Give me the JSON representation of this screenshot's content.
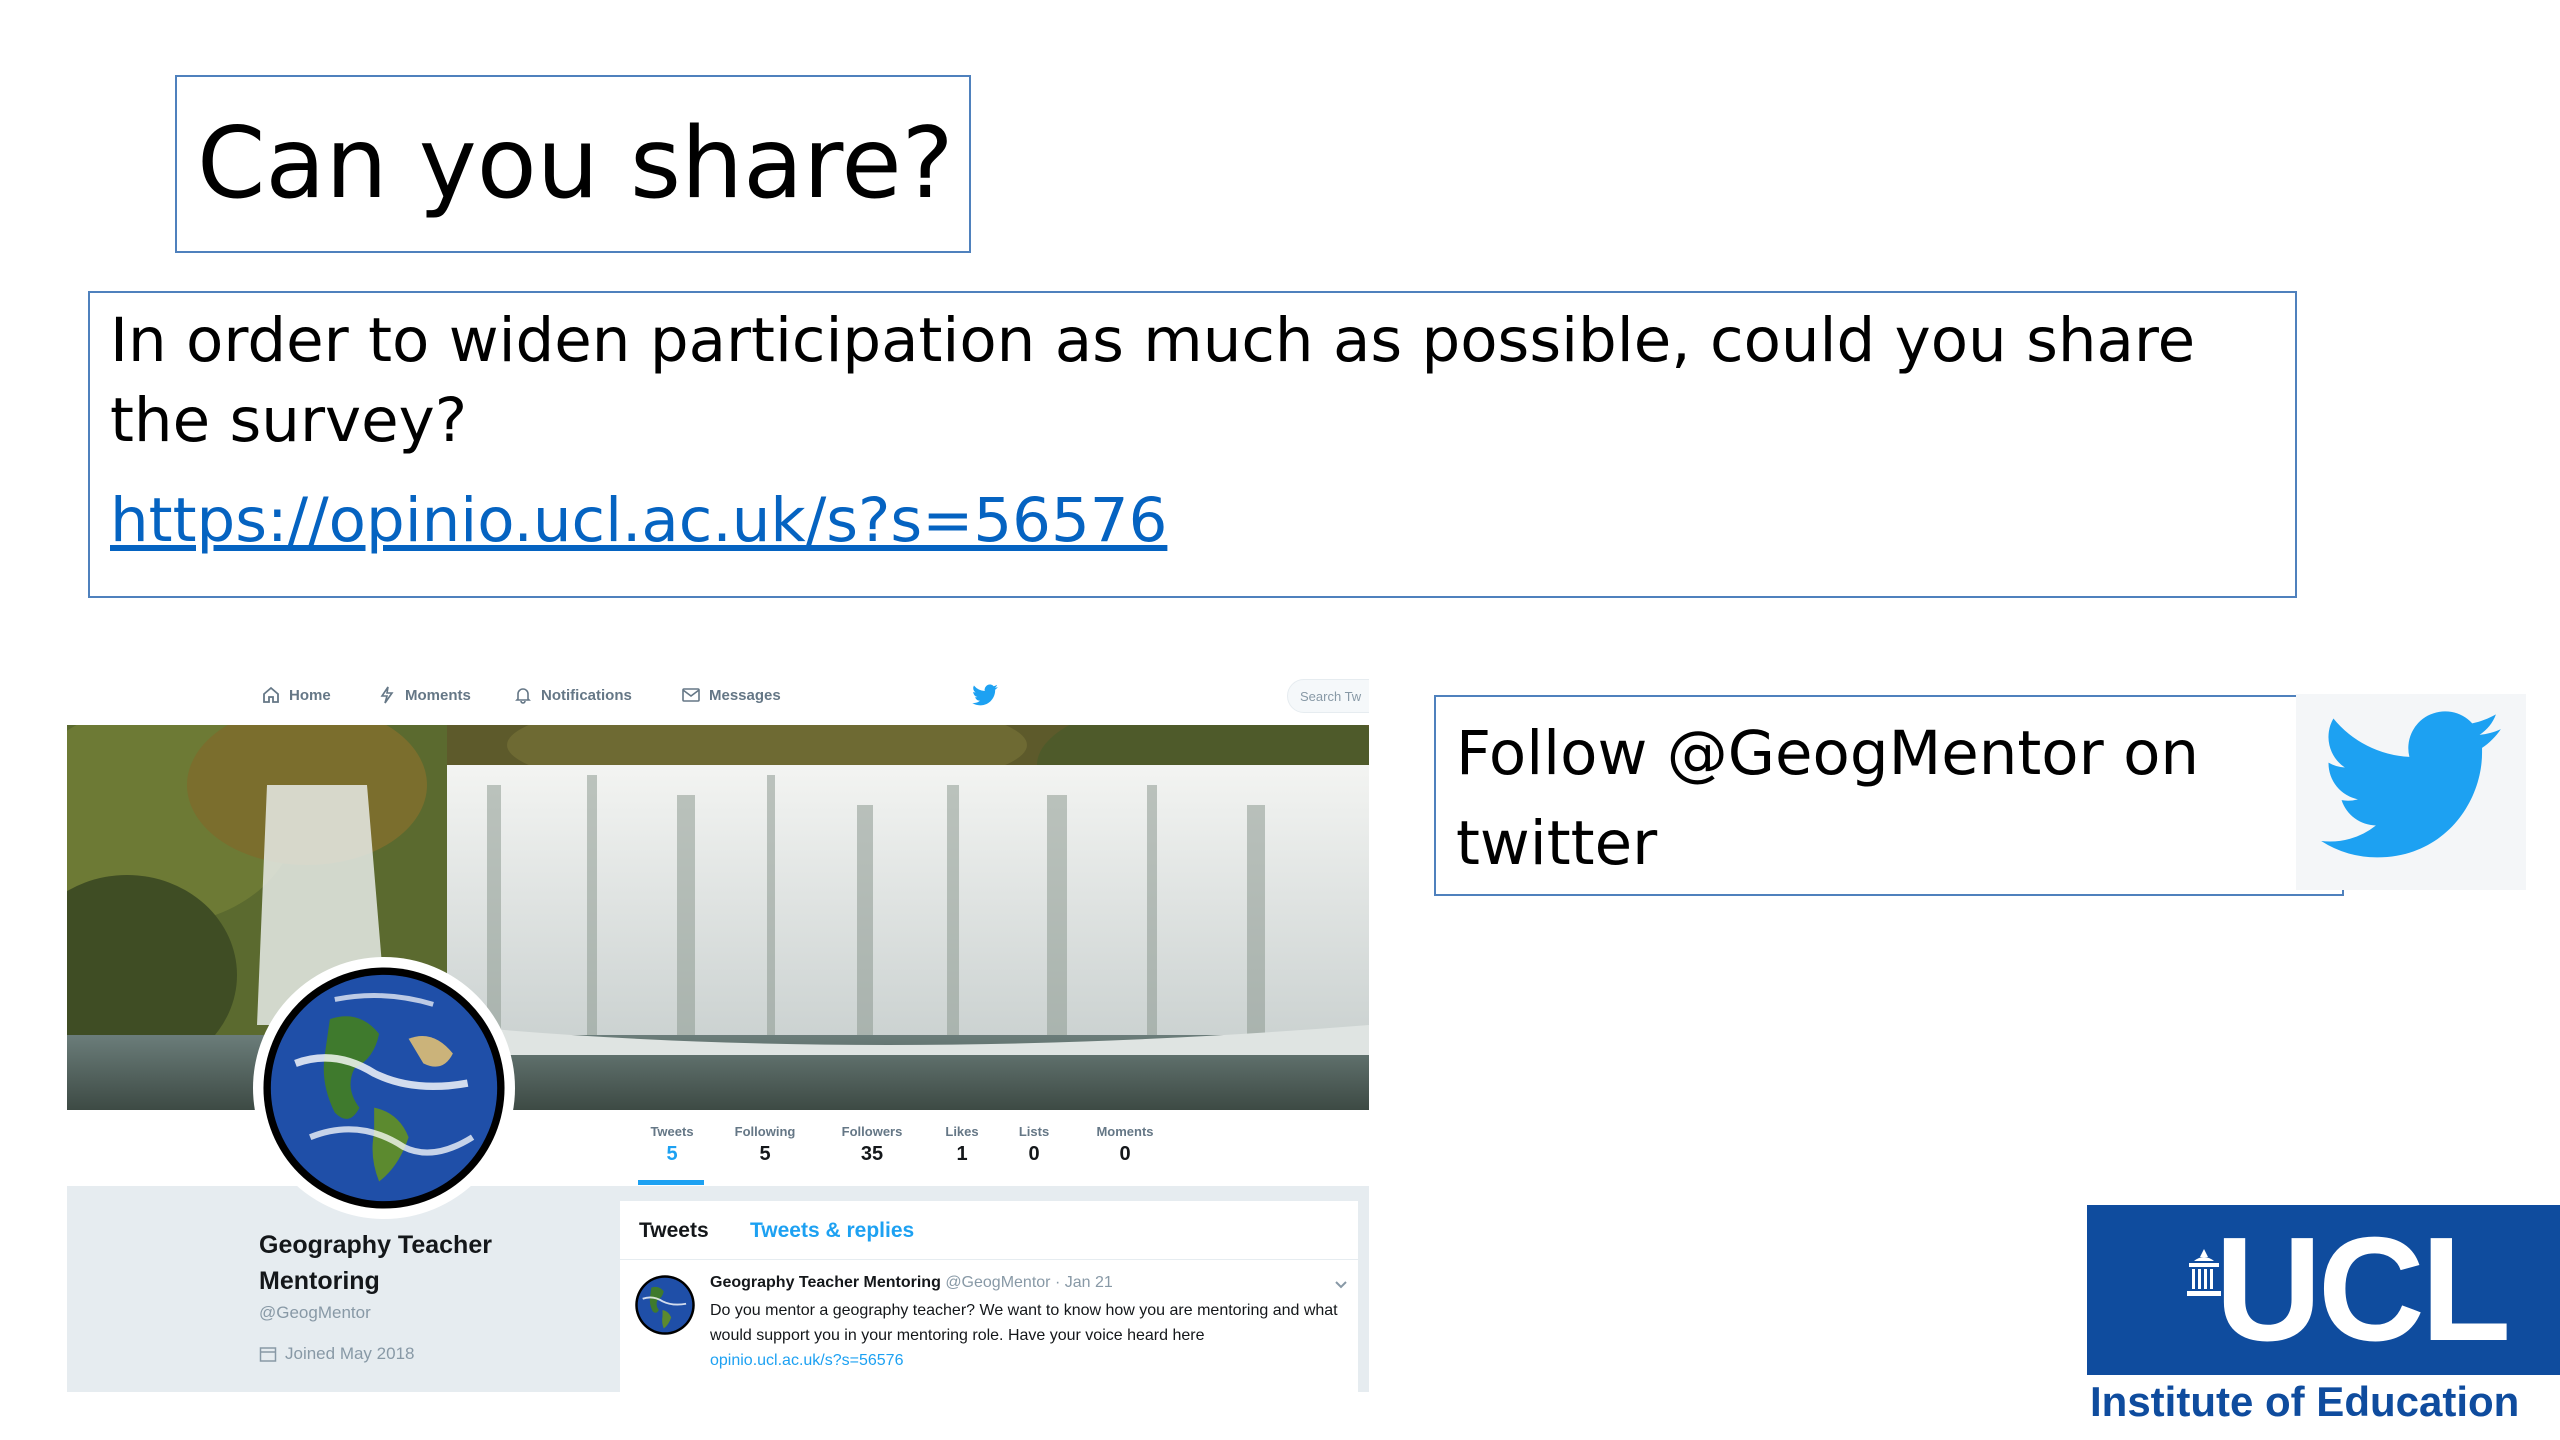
{
  "slide": {
    "title": "Can you share?",
    "body_text": "In order to widen participation as much as possible, could you share the survey?",
    "survey_link": "https://opinio.ucl.ac.uk/s?s=56576",
    "follow_text": "Follow @GeogMentor on twitter"
  },
  "twitter": {
    "nav": {
      "home": "Home",
      "moments": "Moments",
      "notifications": "Notifications",
      "messages": "Messages",
      "search_placeholder": "Search Tw"
    },
    "stats": [
      {
        "label": "Tweets",
        "value": "5"
      },
      {
        "label": "Following",
        "value": "5"
      },
      {
        "label": "Followers",
        "value": "35"
      },
      {
        "label": "Likes",
        "value": "1"
      },
      {
        "label": "Lists",
        "value": "0"
      },
      {
        "label": "Moments",
        "value": "0"
      }
    ],
    "profile": {
      "name": "Geography Teacher Mentoring",
      "handle": "@GeogMentor",
      "joined": "Joined May 2018"
    },
    "timeline": {
      "tab_tweets": "Tweets",
      "tab_replies": "Tweets & replies",
      "tweet": {
        "author": "Geography Teacher Mentoring",
        "meta": "@GeogMentor · Jan 21",
        "text": "Do you mentor a geography teacher? We want to know how you are mentoring and what would support you in your mentoring role. Have your voice heard here",
        "link": "opinio.ucl.ac.uk/s?s=56576"
      }
    },
    "accent_color": "#1da1f2"
  },
  "logo": {
    "text": "UCL",
    "subtitle": "Institute of Education",
    "color": "#0f4c9e"
  }
}
